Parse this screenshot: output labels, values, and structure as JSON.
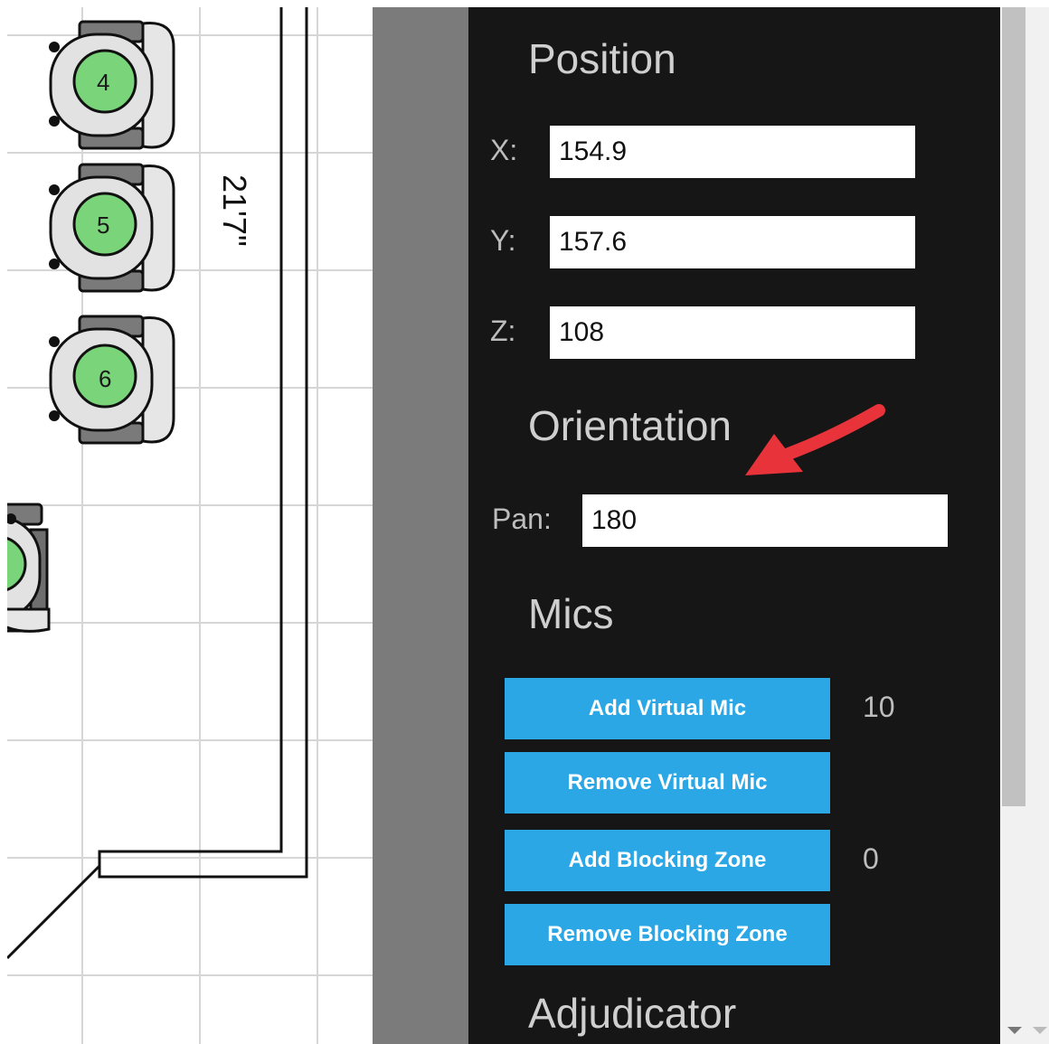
{
  "floor_plan": {
    "dimension_label": "21'7\"",
    "seats": [
      {
        "number": "4"
      },
      {
        "number": "5"
      },
      {
        "number": "6"
      }
    ]
  },
  "panel": {
    "position": {
      "title": "Position",
      "x_label": "X:",
      "x_value": "154.9",
      "y_label": "Y:",
      "y_value": "157.6",
      "z_label": "Z:",
      "z_value": "108"
    },
    "orientation": {
      "title": "Orientation",
      "pan_label": "Pan:",
      "pan_value": "180"
    },
    "mics": {
      "title": "Mics",
      "add_virtual_mic": "Add Virtual Mic",
      "remove_virtual_mic": "Remove Virtual Mic",
      "virtual_mic_count": "10",
      "add_blocking_zone": "Add Blocking Zone",
      "remove_blocking_zone": "Remove Blocking Zone",
      "blocking_zone_count": "0"
    },
    "adjudicator": {
      "title": "Adjudicator"
    }
  },
  "colors": {
    "panel_bg": "#161616",
    "button_bg": "#2ba7e6",
    "seat_green": "#7ad47a",
    "annotation_arrow": "#e8333b"
  },
  "icons": [
    "chair-icon",
    "annotation-arrow-icon",
    "scroll-down-arrow-icon"
  ]
}
